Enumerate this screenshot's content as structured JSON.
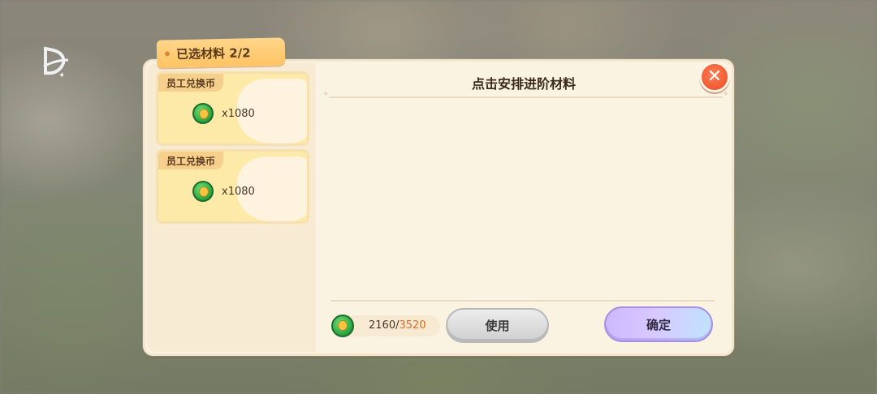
{
  "selected_tab": {
    "label": "已选材料 2/2"
  },
  "materials": [
    {
      "name": "员工兑换币",
      "quantity": "x1080"
    },
    {
      "name": "员工兑换币",
      "quantity": "x1080"
    }
  ],
  "panel": {
    "title": "点击安排进阶材料"
  },
  "counter": {
    "current": "2160",
    "separator": "/",
    "required": "3520"
  },
  "buttons": {
    "use": "使用",
    "confirm": "确定",
    "close": "✕"
  },
  "icons": {
    "logo": "game-logo-icon",
    "coin": "green-coin-icon",
    "close": "close-icon"
  },
  "colors": {
    "accent_orange": "#f05a32",
    "required_text": "#e46a1a",
    "confirm_gradient_start": "#cbb8ff"
  }
}
